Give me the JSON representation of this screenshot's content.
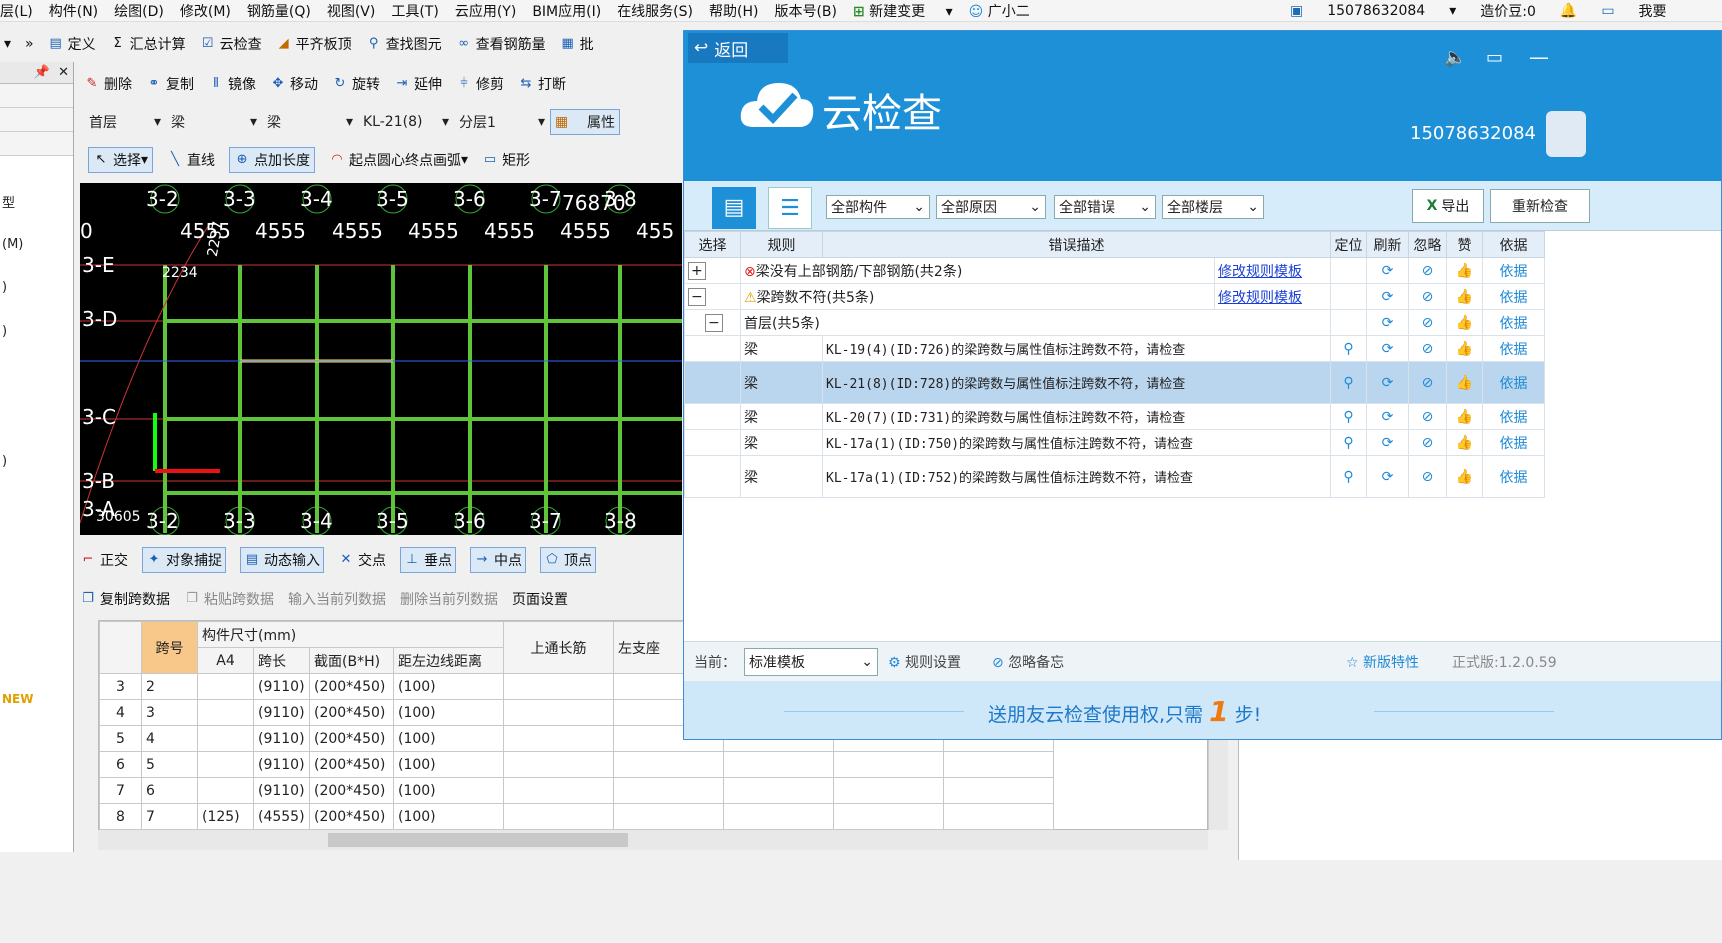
{
  "menu": {
    "items": [
      "层(L)",
      "构件(N)",
      "绘图(D)",
      "修改(M)",
      "钢筋量(Q)",
      "视图(V)",
      "工具(T)",
      "云应用(Y)",
      "BIM应用(I)",
      "在线服务(S)",
      "帮助(H)",
      "版本号(B)",
      "新建变更",
      "广小二"
    ],
    "phone": "15078632084",
    "points": "造价豆:0",
    "want": "我要"
  },
  "toolbar1": [
    "定义",
    "汇总计算",
    "云检查",
    "平齐板顶",
    "查找图元",
    "查看钢筋量",
    "批"
  ],
  "toolbar2": [
    "删除",
    "复制",
    "镜像",
    "移动",
    "旋转",
    "延伸",
    "修剪",
    "打断"
  ],
  "toolbar3": {
    "floor": "首层",
    "type1": "梁",
    "type2": "梁",
    "element": "KL-21(8)",
    "layer": "分层1",
    "props": "属性"
  },
  "toolbar4": [
    "选择",
    "直线",
    "点加长度",
    "起点圆心终点画弧",
    "矩形"
  ],
  "left_panel": {
    "items": [
      "型",
      "(M)",
      ")",
      ")",
      ")",
      "NEW"
    ]
  },
  "cad": {
    "top_axes": [
      "3-2",
      "3-3",
      "3-4",
      "3-5",
      "3-6",
      "3-7",
      "3-8"
    ],
    "bottom_axes": [
      "3-2",
      "3-3",
      "3-4",
      "3-5",
      "3-6",
      "3-7",
      "3-8"
    ],
    "dims": [
      "4555",
      "4555",
      "4555",
      "4555",
      "4555",
      "4555",
      "455"
    ],
    "left_axes": [
      "3-E",
      "3-D",
      "3-C",
      "3-B",
      "3-A"
    ],
    "misc": [
      "76870",
      "2234",
      "2237",
      "30605",
      "0"
    ]
  },
  "snap_bar": [
    "正交",
    "对象捕捉",
    "动态输入",
    "交点",
    "垂点",
    "中点",
    "顶点"
  ],
  "span_toolbar": [
    "复制跨数据",
    "粘贴跨数据",
    "输入当前列数据",
    "删除当前列数据",
    "页面设置"
  ],
  "grid": {
    "h_span": "跨号",
    "h_size": "构件尺寸(mm)",
    "h_top": "上通长筋",
    "h_left": "左支座",
    "h_sub": [
      "A4",
      "跨长",
      "截面(B*H)",
      "距左边线距离"
    ],
    "rows": [
      [
        "3",
        "2",
        "",
        "(9110)",
        "(200*450)",
        "(100)"
      ],
      [
        "4",
        "3",
        "",
        "(9110)",
        "(200*450)",
        "(100)"
      ],
      [
        "5",
        "4",
        "",
        "(9110)",
        "(200*450)",
        "(100)"
      ],
      [
        "6",
        "5",
        "",
        "(9110)",
        "(200*450)",
        "(100)"
      ],
      [
        "7",
        "6",
        "",
        "(9110)",
        "(200*450)",
        "(100)"
      ],
      [
        "8",
        "7",
        "(125)",
        "(4555)",
        "(200*450)",
        "(100)"
      ]
    ]
  },
  "cloud": {
    "back": "返回",
    "title": "云检查",
    "phone": "15078632084",
    "filters": [
      "全部构件",
      "全部原因",
      "全部错误",
      "全部楼层"
    ],
    "export": "导出",
    "recheck": "重新检查",
    "cols": [
      "选择",
      "规则",
      "错误描述",
      "定位",
      "刷新",
      "忽略",
      "赞",
      "依据"
    ],
    "groups": [
      {
        "expand": "+",
        "text": "梁没有上部钢筋/下部钢筋(共2条)",
        "link": "修改规则模板",
        "basis": "依据"
      },
      {
        "expand": "−",
        "text": "梁跨数不符(共5条)",
        "link": "修改规则模板",
        "basis": "依据"
      },
      {
        "expand": "−",
        "text": "首层(共5条)",
        "link": "",
        "basis": "依据"
      }
    ],
    "rows": [
      {
        "rule": "梁",
        "desc": "KL-19(4)(ID:726)的梁跨数与属性值标注跨数不符，请检查",
        "basis": "依据"
      },
      {
        "rule": "梁",
        "desc": "KL-21(8)(ID:728)的梁跨数与属性值标注跨数不符，请检查",
        "basis": "依据"
      },
      {
        "rule": "梁",
        "desc": "KL-20(7)(ID:731)的梁跨数与属性值标注跨数不符，请检查",
        "basis": "依据"
      },
      {
        "rule": "梁",
        "desc": "KL-17a(1)(ID:750)的梁跨数与属性值标注跨数不符，请检查",
        "basis": "依据"
      },
      {
        "rule": "梁",
        "desc": "KL-17a(1)(ID:752)的梁跨数与属性值标注跨数不符，请检查",
        "basis": "依据"
      }
    ],
    "bottom": {
      "current_label": "当前：",
      "template": "标准模板",
      "rule_settings": "规则设置",
      "ignore_memo": "忽略备忘",
      "new_features": "新版特性",
      "version": "正式版:1.2.0.59"
    },
    "banner": {
      "pre": "送朋友云检查使用权,只需",
      "num": "1",
      "post": "步!"
    }
  }
}
